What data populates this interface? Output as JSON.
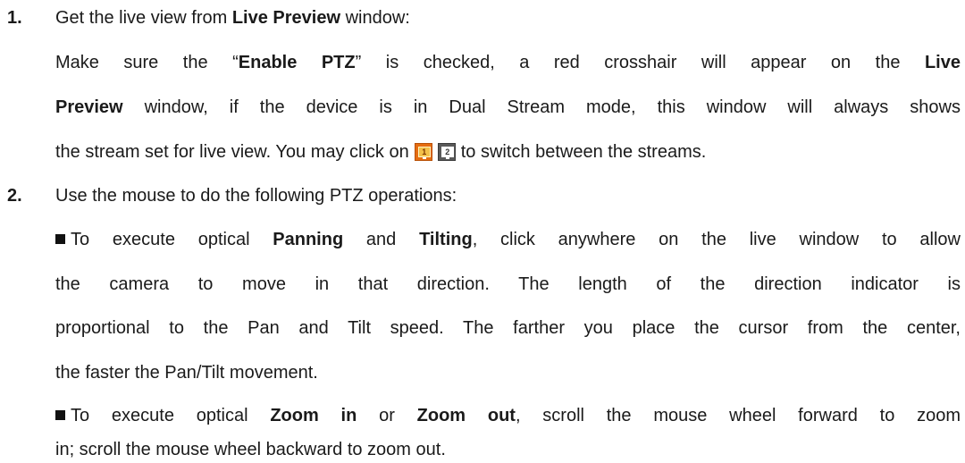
{
  "step1": {
    "number": "1.",
    "intro_pre": "Get the live view from ",
    "intro_bold": "Live Preview",
    "intro_post": " window:",
    "l2_a": "Make sure the “",
    "l2_b": "Enable PTZ",
    "l2_c": "” is checked, a red crosshair will appear on the ",
    "l2_d": "Live",
    "l3_a": "Preview",
    "l3_b": " window, if the device is in Dual Stream mode, this window will always shows",
    "l4_a": "the stream set for live view. You may click on",
    "l4_b": "to switch between the streams.",
    "stream_icons": [
      {
        "label": "1",
        "icon": "stream-1-monitor-icon",
        "color": "#e56d10"
      },
      {
        "label": "2",
        "icon": "stream-2-monitor-icon",
        "color": "#5a5a5a"
      }
    ]
  },
  "step2": {
    "number": "2.",
    "intro": "Use the mouse to do the following PTZ operations:",
    "p1_l1_a": "To execute optical ",
    "p1_l1_b": "Panning",
    "p1_l1_c": " and ",
    "p1_l1_d": "Tilting",
    "p1_l1_e": ", click anywhere on the live window to allow",
    "p1_l2": "the camera to move in that direction. The length of the direction indicator is",
    "p1_l3": "proportional to the Pan and Tilt speed. The farther you place the cursor from the center,",
    "p1_l4": "the faster the Pan/Tilt movement.",
    "p2_l1_a": "To execute optical ",
    "p2_l1_b": "Zoom in",
    "p2_l1_c": " or ",
    "p2_l1_d": "Zoom out",
    "p2_l1_e": ", scroll the mouse wheel forward to zoom",
    "p2_l2": "in; scroll the mouse wheel backward to zoom out."
  }
}
